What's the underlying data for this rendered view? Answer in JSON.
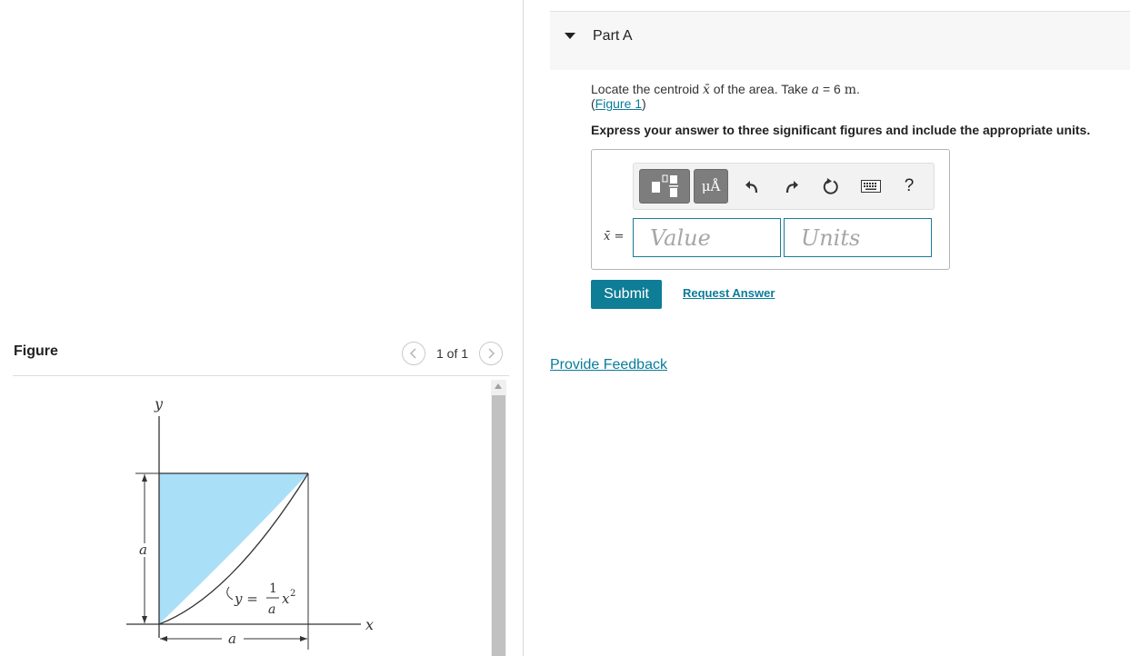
{
  "figure_panel": {
    "title": "Figure",
    "pager_text": "1 of 1",
    "diagram": {
      "y_axis_label": "y",
      "x_axis_label": "x",
      "height_dimension_label": "a",
      "width_dimension_label": "a",
      "curve_eq_y": "y =",
      "curve_eq_num": "1",
      "curve_eq_den": "a",
      "curve_eq_var": "x",
      "curve_eq_exp": "2",
      "fill_color": "#aadff8"
    }
  },
  "part": {
    "title": "Part A",
    "question_prefix": "Locate the centroid",
    "question_symbol": "x̄",
    "question_middle": "of the area. Take",
    "question_var": "a",
    "question_value": "= 6",
    "question_unit": "m",
    "question_end": ".",
    "figure_link_open": "(",
    "figure_link_text": "Figure 1",
    "figure_link_close": ")",
    "instructions": "Express your answer to three significant figures and include the appropriate units."
  },
  "answer": {
    "variable_label": "x̄ =",
    "value_placeholder": "Value",
    "units_placeholder": "Units",
    "toolbar": {
      "symbol_label": "μÅ",
      "help_label": "?"
    }
  },
  "actions": {
    "submit_label": "Submit",
    "request_answer_label": "Request Answer",
    "provide_feedback_label": "Provide Feedback"
  },
  "colors": {
    "accent": "#0e7d96",
    "link": "#0a7c9a",
    "input_border": "#1a7c94"
  }
}
